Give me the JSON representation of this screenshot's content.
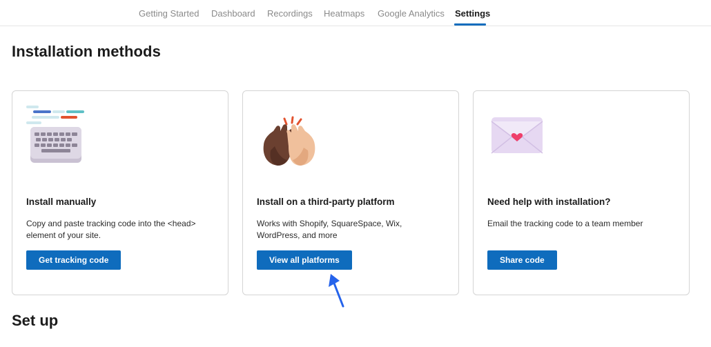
{
  "nav": {
    "tabs": [
      {
        "label": "Getting Started",
        "active": false
      },
      {
        "label": "Dashboard",
        "active": false
      },
      {
        "label": "Recordings",
        "active": false
      },
      {
        "label": "Heatmaps",
        "active": false
      },
      {
        "label": "Google Analytics",
        "active": false
      },
      {
        "label": "Settings",
        "active": true
      }
    ]
  },
  "page": {
    "title": "Installation methods",
    "section2_title": "Set up"
  },
  "cards": [
    {
      "icon": "keyboard-icon",
      "title": "Install manually",
      "description": "Copy and paste tracking code into the <head> element of your site.",
      "button": "Get tracking code"
    },
    {
      "icon": "high-five-icon",
      "title": "Install on a third-party platform",
      "description": "Works with Shopify, SquareSpace, Wix, WordPress, and more",
      "button": "View all platforms"
    },
    {
      "icon": "love-letter-icon",
      "title": "Need help with installation?",
      "description": "Email the tracking code to a team member",
      "button": "Share code"
    }
  ],
  "colors": {
    "accent": "#0f6cbd",
    "annotation_arrow": "#2563eb"
  }
}
